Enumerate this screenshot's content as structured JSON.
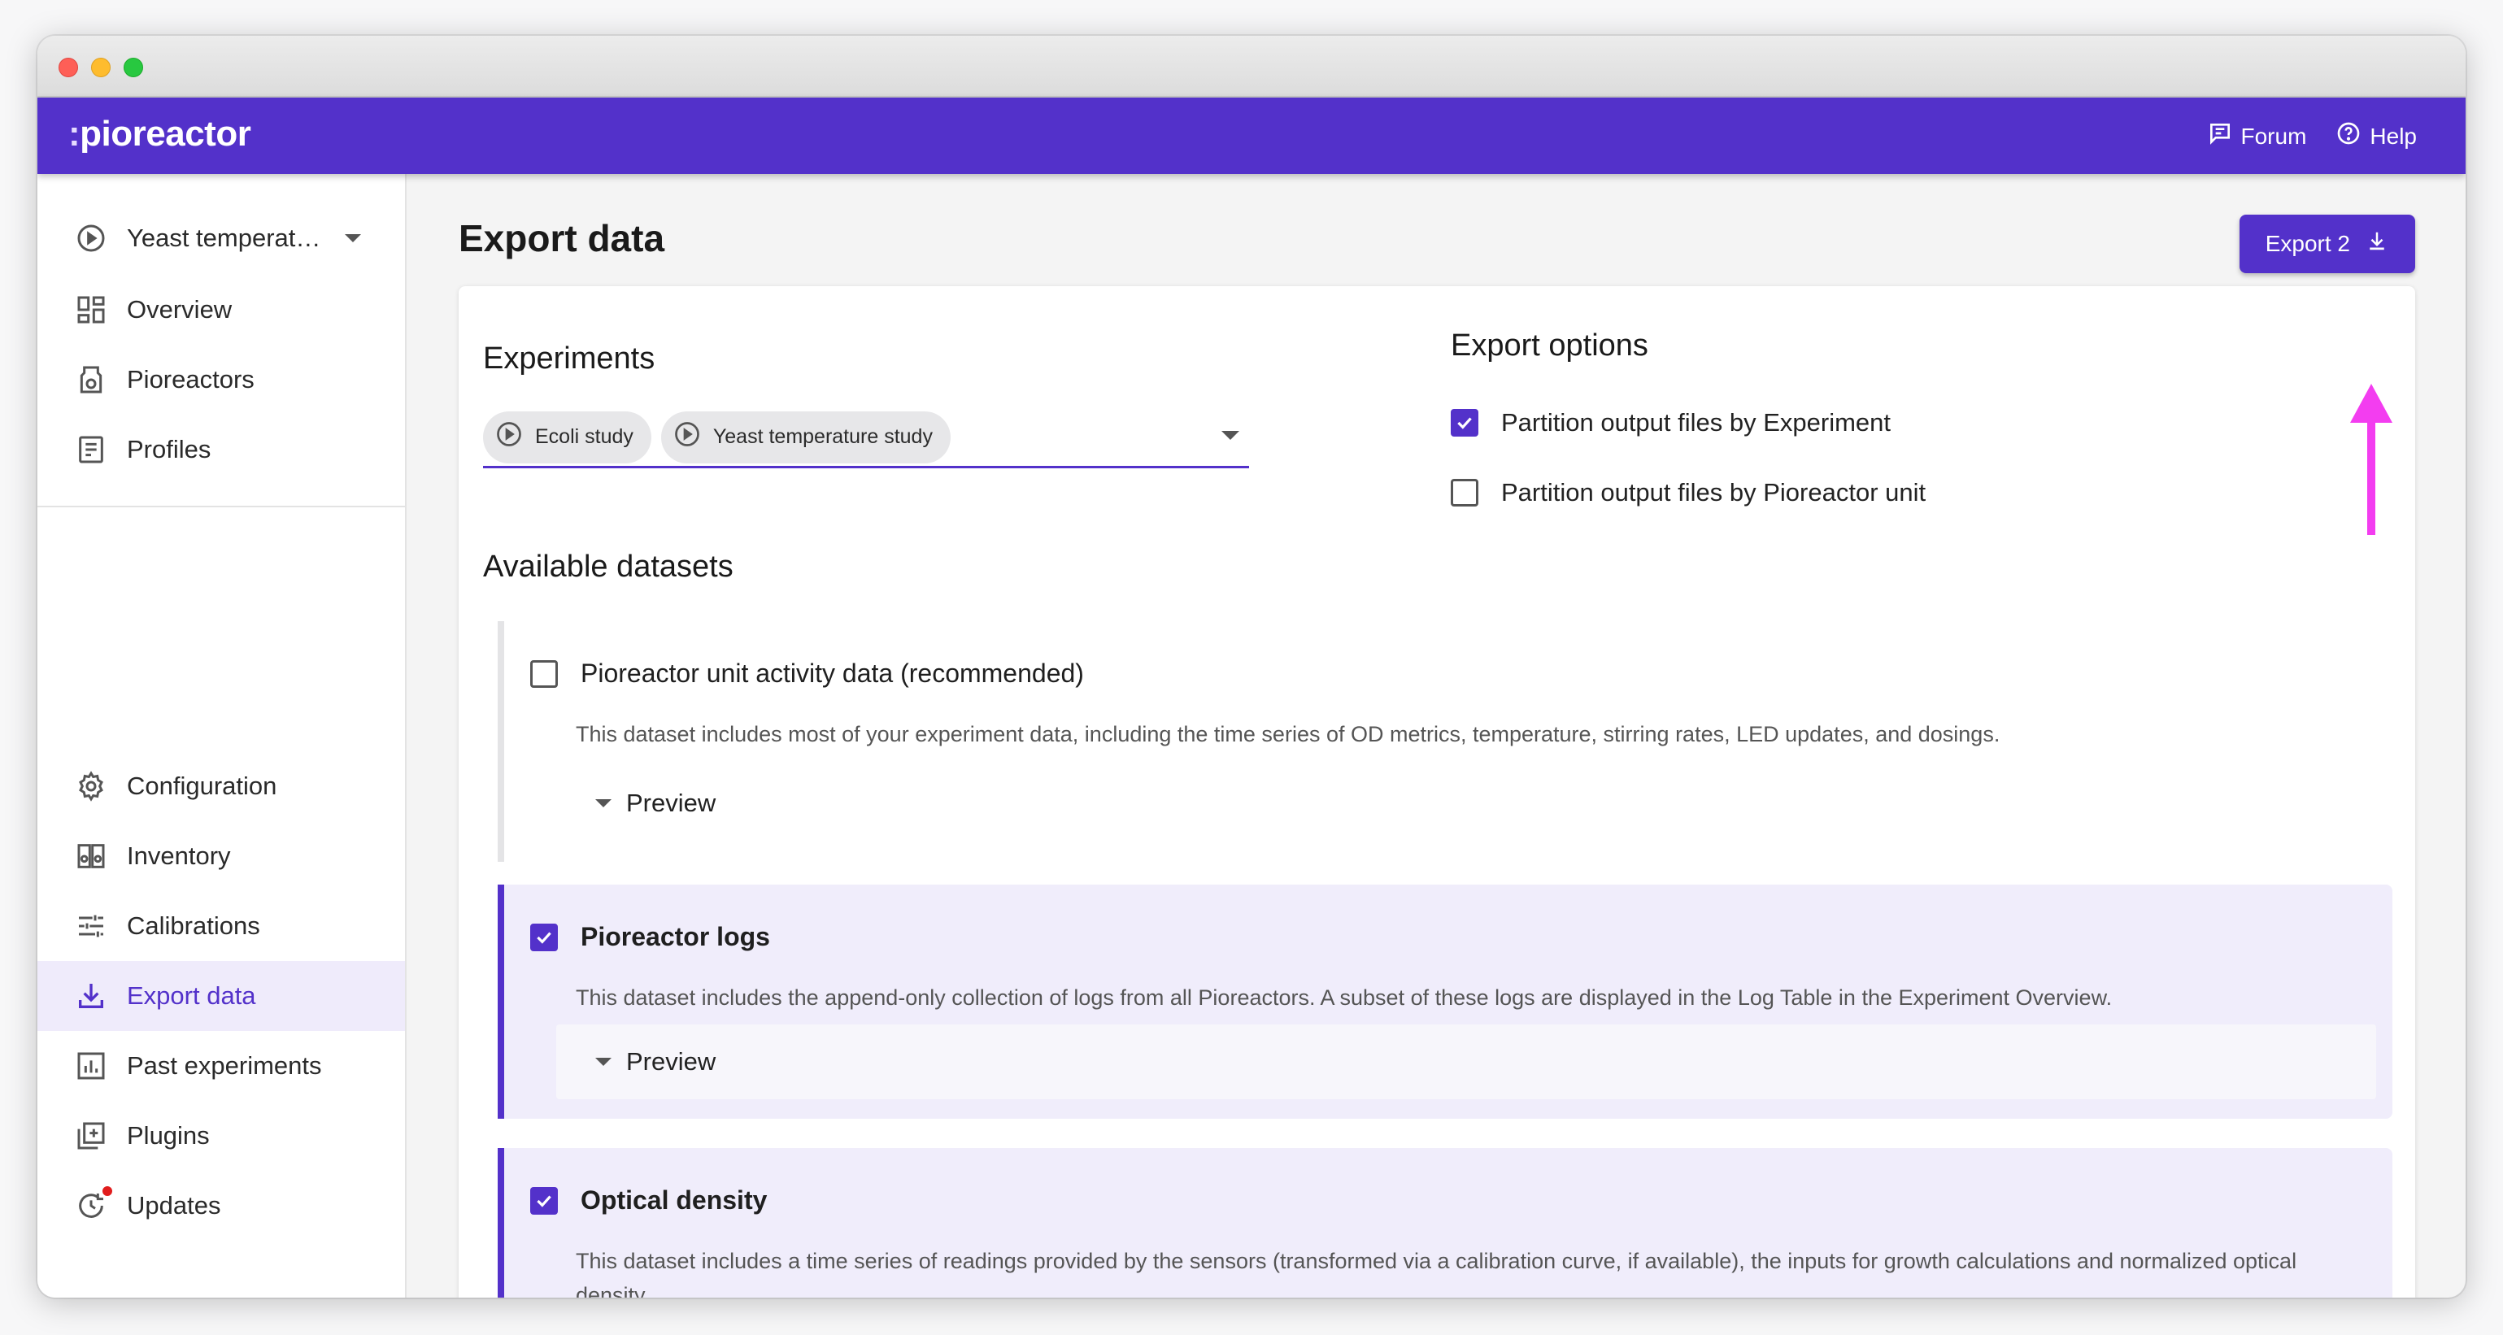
{
  "app": {
    "logo_text": "pioreactor",
    "logo_dots": ":"
  },
  "topnav": {
    "forum": "Forum",
    "help": "Help"
  },
  "sidebar": {
    "experiment_selector": "Yeast temperat…",
    "items": [
      {
        "label": "Overview",
        "icon": "dashboard-icon"
      },
      {
        "label": "Pioreactors",
        "icon": "bioreactor-icon"
      },
      {
        "label": "Profiles",
        "icon": "document-icon"
      },
      {
        "label": "Configuration",
        "icon": "gear-icon"
      },
      {
        "label": "Inventory",
        "icon": "inventory-icon"
      },
      {
        "label": "Calibrations",
        "icon": "sliders-icon"
      },
      {
        "label": "Export data",
        "icon": "download-icon",
        "active": true
      },
      {
        "label": "Past experiments",
        "icon": "chart-icon"
      },
      {
        "label": "Plugins",
        "icon": "add-box-icon"
      },
      {
        "label": "Updates",
        "icon": "update-icon",
        "notification": true
      }
    ]
  },
  "page": {
    "title": "Export data",
    "export_button": "Export 2"
  },
  "experiments": {
    "heading": "Experiments",
    "chips": [
      "Ecoli study",
      "Yeast temperature study"
    ]
  },
  "export_options": {
    "heading": "Export options",
    "partition_by_experiment": {
      "label": "Partition output files by Experiment",
      "checked": true
    },
    "partition_by_unit": {
      "label": "Partition output files by Pioreactor unit",
      "checked": false
    }
  },
  "datasets": {
    "heading": "Available datasets",
    "items": [
      {
        "title": "Pioreactor unit activity data (recommended)",
        "description": "This dataset includes most of your experiment data, including the time series of OD metrics, temperature, stirring rates, LED updates, and dosings.",
        "checked": false,
        "preview": "Preview"
      },
      {
        "title": "Pioreactor logs",
        "description": "This dataset includes the append-only collection of logs from all Pioreactors. A subset of these logs are displayed in the Log Table in the Experiment Overview.",
        "checked": true,
        "preview": "Preview"
      },
      {
        "title": "Optical density",
        "description": "This dataset includes a time series of readings provided by the sensors (transformed via a calibration curve, if available), the inputs for growth calculations and normalized optical density.",
        "checked": true
      }
    ]
  },
  "colors": {
    "brand": "#5331ca",
    "annotation_arrow": "#f33df0"
  }
}
